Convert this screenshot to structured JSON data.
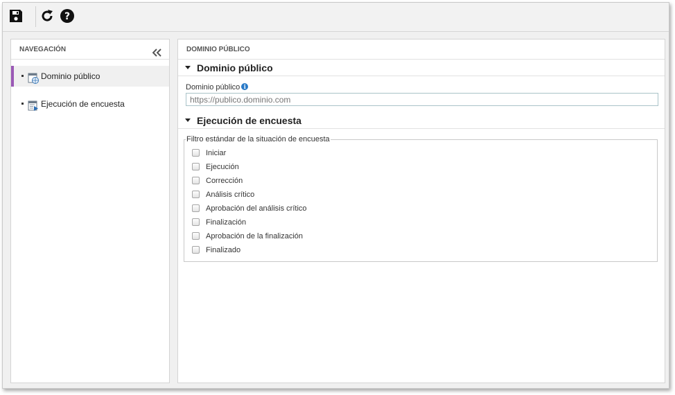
{
  "toolbar": {
    "buttons": [
      "save-icon",
      "refresh-icon",
      "help-icon"
    ]
  },
  "nav": {
    "title": "NAVEGACIÓN",
    "items": [
      {
        "label": "Dominio público",
        "icon": "web-page-icon",
        "selected": true
      },
      {
        "label": "Ejecución de encuesta",
        "icon": "survey-execution-icon",
        "selected": false
      }
    ]
  },
  "main": {
    "title": "DOMINIO PÚBLICO",
    "sections": {
      "domain": {
        "title": "Dominio público",
        "field_label": "Dominio público",
        "field_placeholder": "https://publico.dominio.com",
        "field_value": ""
      },
      "survey": {
        "title": "Ejecución de encuesta",
        "legend": "Filtro estándar de la situación de encuesta",
        "options": [
          {
            "label": "Iniciar",
            "checked": false
          },
          {
            "label": "Ejecución",
            "checked": false
          },
          {
            "label": "Corrección",
            "checked": false
          },
          {
            "label": "Análisis crítico",
            "checked": false
          },
          {
            "label": "Aprobación del análisis crítico",
            "checked": false
          },
          {
            "label": "Finalización",
            "checked": false
          },
          {
            "label": "Aprobación de la finalización",
            "checked": false
          },
          {
            "label": "Finalizado",
            "checked": false
          }
        ]
      }
    }
  },
  "colors": {
    "selected_accent": "#9b59b6",
    "info": "#2a7ac7"
  }
}
